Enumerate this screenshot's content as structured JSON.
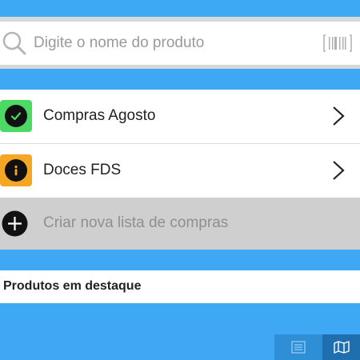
{
  "search": {
    "placeholder": "Digite o nome do produto"
  },
  "lists": [
    {
      "label": "Compras Agosto",
      "icon": "check-icon",
      "color": "#4cd964"
    },
    {
      "label": "Doces FDS",
      "icon": "info-icon",
      "color": "#f5a623"
    }
  ],
  "create_list": {
    "label": "Criar nova lista de compras"
  },
  "featured": {
    "title": "Produtos em destaque"
  },
  "bottom_tabs": [
    {
      "icon": "list-icon"
    },
    {
      "icon": "map-icon"
    }
  ],
  "colors": {
    "accent": "#3fa8f4",
    "success": "#4cd964",
    "warning": "#f5a623"
  }
}
